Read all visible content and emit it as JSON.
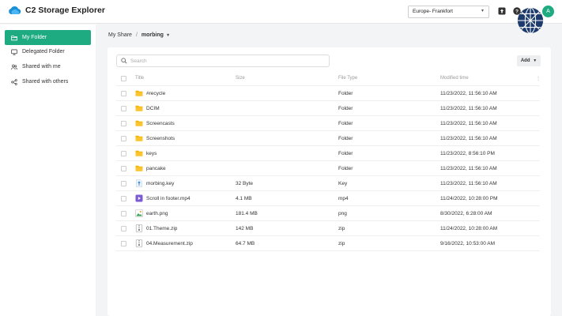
{
  "app": {
    "title": "C2 Storage Explorer",
    "brand_color": "#1eab82"
  },
  "header": {
    "region": "Europe- Frankfort",
    "icons": [
      "upload-box-icon",
      "help-icon",
      "globe-icon"
    ],
    "avatar_initial": "A"
  },
  "sidebar": {
    "items": [
      {
        "label": "My Folder",
        "icon": "folder-icon",
        "active": true
      },
      {
        "label": "Delegated Folder",
        "icon": "delegated-folder-icon",
        "active": false
      },
      {
        "label": "Shared with me",
        "icon": "users-icon",
        "active": false
      },
      {
        "label": "Shared with others",
        "icon": "share-icon",
        "active": false
      }
    ]
  },
  "breadcrumb": {
    "root": "My Share",
    "separator": "/",
    "current": "morbing"
  },
  "toolbar": {
    "search_placeholder": "Search",
    "add_label": "Add"
  },
  "table": {
    "columns": {
      "title": "Title",
      "size": "Size",
      "type": "File Type",
      "modified": "Modified time"
    },
    "rows": [
      {
        "name": "#recycle",
        "size": "",
        "type": "Folder",
        "modified": "11/23/2022, 11:56:10 AM",
        "icon": "folder-icon"
      },
      {
        "name": "DCIM",
        "size": "",
        "type": "Folder",
        "modified": "11/23/2022, 11:56:10 AM",
        "icon": "folder-icon"
      },
      {
        "name": "Screencasts",
        "size": "",
        "type": "Folder",
        "modified": "11/23/2022, 11:56:10 AM",
        "icon": "folder-icon"
      },
      {
        "name": "Screenshots",
        "size": "",
        "type": "Folder",
        "modified": "11/23/2022, 11:56:10 AM",
        "icon": "folder-icon"
      },
      {
        "name": "keys",
        "size": "",
        "type": "Folder",
        "modified": "11/23/2022, 8:56:10 PM",
        "icon": "folder-icon"
      },
      {
        "name": "pancake",
        "size": "",
        "type": "Folder",
        "modified": "11/23/2022, 11:56:10 AM",
        "icon": "folder-icon"
      },
      {
        "name": "morbing.key",
        "size": "32 Byte",
        "type": "Key",
        "modified": "11/23/2022, 11:56:10 AM",
        "icon": "key-file-icon"
      },
      {
        "name": "Scroll in footer.mp4",
        "size": "4.1 MB",
        "type": "mp4",
        "modified": "11/24/2022, 10:28:00 PM",
        "icon": "video-file-icon"
      },
      {
        "name": "earth.png",
        "size": "181.4 MB",
        "type": "png",
        "modified": "8/30/2022, 6:28:00 AM",
        "icon": "image-file-icon"
      },
      {
        "name": "01.Theme.zip",
        "size": "142 MB",
        "type": "zip",
        "modified": "11/24/2022, 10:28:00 AM",
        "icon": "zip-file-icon"
      },
      {
        "name": "04.Measurement.zip",
        "size": "64.7 MB",
        "type": "zip",
        "modified": "9/16/2022, 10:53:00 AM",
        "icon": "zip-file-icon"
      }
    ]
  }
}
